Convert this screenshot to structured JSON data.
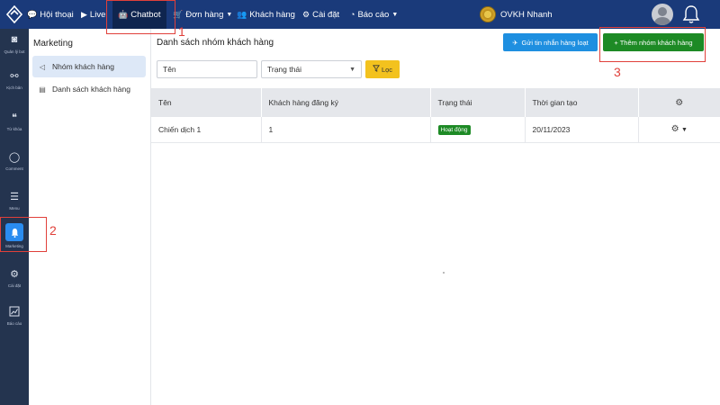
{
  "topbar": {
    "nav": [
      {
        "label": "Hội thoại",
        "icon": "chat-icon"
      },
      {
        "label": "Live",
        "icon": "video-icon"
      },
      {
        "label": "Chatbot",
        "icon": "robot-icon"
      },
      {
        "label": "Đơn hàng",
        "icon": "cart-icon"
      },
      {
        "label": "Khách hàng",
        "icon": "users-icon"
      },
      {
        "label": "Cài đặt",
        "icon": "gear-icon"
      },
      {
        "label": "Báo cáo",
        "icon": "chart-icon"
      }
    ],
    "brand": "OVKH Nhanh"
  },
  "rail": {
    "items": [
      {
        "label": "Quản lý bot",
        "icon": "robot-icon"
      },
      {
        "label": "Kịch bản",
        "icon": "flow-icon"
      },
      {
        "label": "Từ khóa",
        "icon": "keyword-icon"
      },
      {
        "label": "Comment",
        "icon": "comment-icon"
      },
      {
        "label": "Menu",
        "icon": "menu-icon"
      },
      {
        "label": "Marketing",
        "icon": "bell-icon"
      },
      {
        "label": "Cài đặt",
        "icon": "gear-icon"
      },
      {
        "label": "Báo cáo",
        "icon": "chart-icon"
      }
    ]
  },
  "sidebar": {
    "title": "Marketing",
    "items": [
      {
        "label": "Nhóm khách hàng"
      },
      {
        "label": "Danh sách khách hàng"
      }
    ]
  },
  "main": {
    "title": "Danh sách nhóm khách hàng",
    "send_button": "Gửi tin nhắn hàng loạt",
    "add_button": "+ Thêm nhóm khách hàng",
    "filter": {
      "name_value": "Tên",
      "status_value": "Trạng thái",
      "filter_button": "Lọc"
    },
    "table": {
      "headers": [
        "Tên",
        "Khách hàng đăng ký",
        "Trạng thái",
        "Thời gian tạo"
      ],
      "rows": [
        {
          "name": "Chiến dịch 1",
          "subscribers": "1",
          "status": "Hoạt động",
          "created": "20/11/2023"
        }
      ]
    }
  },
  "annotations": [
    "1",
    "2",
    "3"
  ],
  "colors": {
    "topbar": "#1a3a7a",
    "rail": "#24344f",
    "send_button": "#1e8fe0",
    "add_button": "#1d8a25",
    "filter_button": "#f3c21e",
    "annotation": "#e0403a"
  }
}
